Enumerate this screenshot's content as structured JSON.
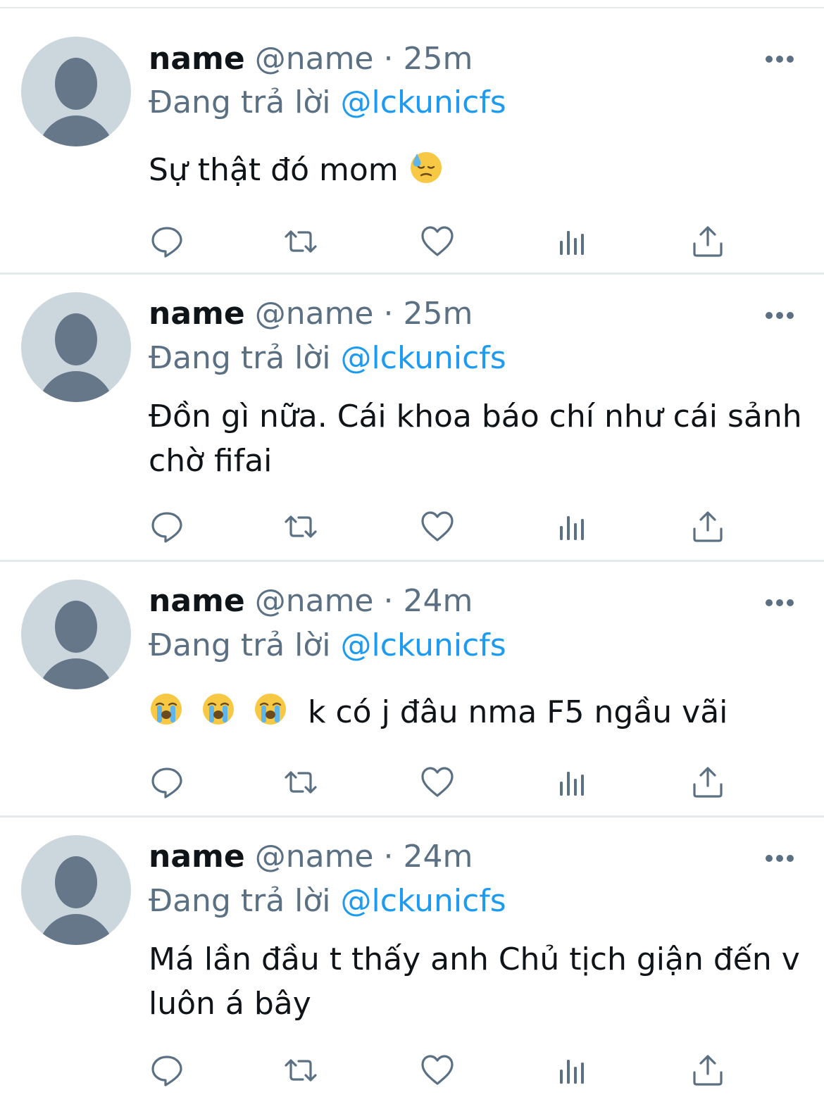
{
  "colors": {
    "text": "#0f1419",
    "secondary": "#5b7083",
    "mention": "#1d9bf0",
    "divider": "#e6e9ec",
    "avatar_bg": "#ccd6dd",
    "avatar_fg": "#66778a"
  },
  "icons": {
    "more": "more-horizontal-icon",
    "reply": "reply-icon",
    "retweet": "retweet-icon",
    "like": "heart-icon",
    "analytics": "analytics-icon",
    "share": "share-icon"
  },
  "tweets": [
    {
      "name": "name",
      "handle": "@name",
      "separator": "·",
      "time": "25m",
      "reply_prefix": "Đang trả lời",
      "reply_to": "@lckunicfs",
      "text": "Sự thật đó mom",
      "emoji": "downcast-sweat-face"
    },
    {
      "name": "name",
      "handle": "@name",
      "separator": "·",
      "time": "25m",
      "reply_prefix": "Đang trả lời",
      "reply_to": "@lckunicfs",
      "text": "Đồn gì nữa. Cái khoa báo chí như cái sảnh chờ fifai"
    },
    {
      "name": "name",
      "handle": "@name",
      "separator": "·",
      "time": "24m",
      "reply_prefix": "Đang trả lời",
      "reply_to": "@lckunicfs",
      "text": "k có j đâu nma F5 ngầu vãi",
      "emoji": "loudly-crying-face"
    },
    {
      "name": "name",
      "handle": "@name",
      "separator": "·",
      "time": "24m",
      "reply_prefix": "Đang trả lời",
      "reply_to": "@lckunicfs",
      "text": "Má lần đầu t thấy anh Chủ tịch giận đến v luôn á bây"
    }
  ]
}
